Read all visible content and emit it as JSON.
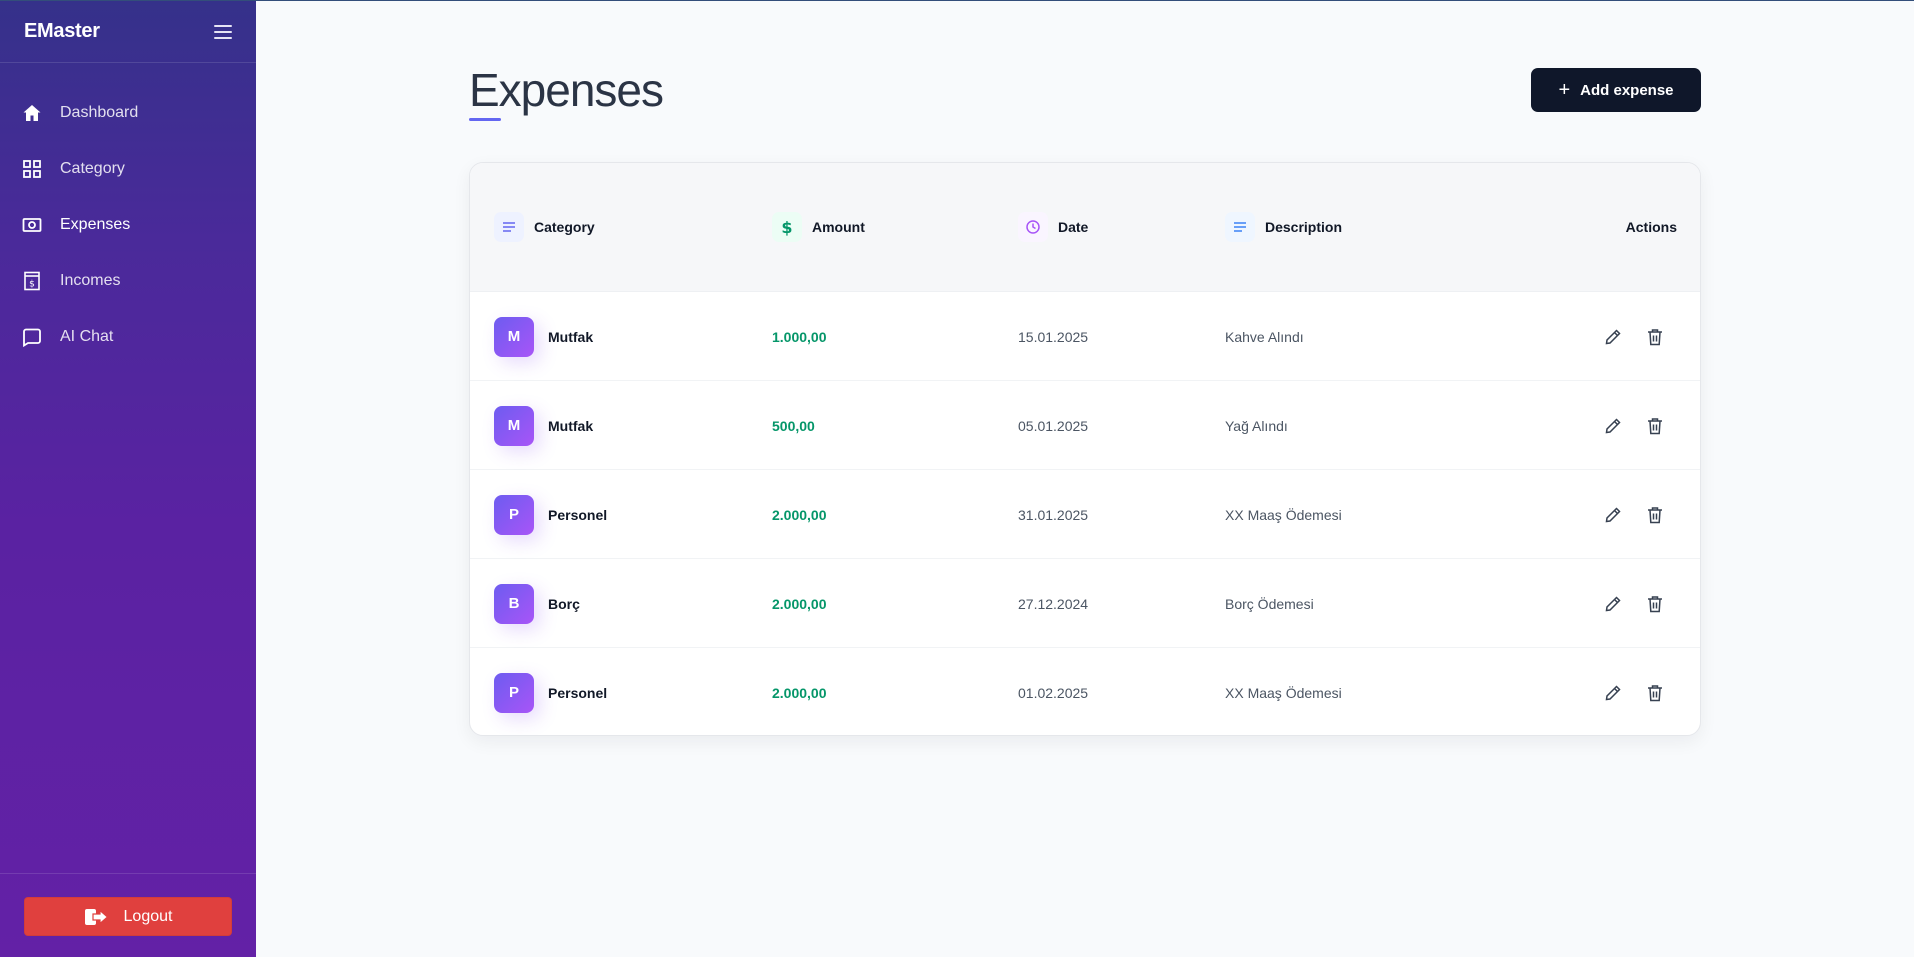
{
  "app": {
    "brand": "EMaster"
  },
  "sidebar": {
    "items": [
      {
        "label": "Dashboard",
        "icon": "home-icon"
      },
      {
        "label": "Category",
        "icon": "grid-icon"
      },
      {
        "label": "Expenses",
        "icon": "cash-icon",
        "active": true
      },
      {
        "label": "Incomes",
        "icon": "receipt-icon"
      },
      {
        "label": "AI Chat",
        "icon": "chat-icon"
      }
    ],
    "logout_label": "Logout"
  },
  "page": {
    "title": "Expenses",
    "add_button_label": "Add expense"
  },
  "table": {
    "headers": {
      "category": "Category",
      "amount": "Amount",
      "date": "Date",
      "description": "Description",
      "actions": "Actions"
    },
    "rows": [
      {
        "initial": "M",
        "category": "Mutfak",
        "amount": "1.000,00",
        "date": "15.01.2025",
        "description": "Kahve Alındı"
      },
      {
        "initial": "M",
        "category": "Mutfak",
        "amount": "500,00",
        "date": "05.01.2025",
        "description": "Yağ Alındı"
      },
      {
        "initial": "P",
        "category": "Personel",
        "amount": "2.000,00",
        "date": "31.01.2025",
        "description": "XX Maaş Ödemesi"
      },
      {
        "initial": "B",
        "category": "Borç",
        "amount": "2.000,00",
        "date": "27.12.2024",
        "description": "Borç Ödemesi"
      },
      {
        "initial": "P",
        "category": "Personel",
        "amount": "2.000,00",
        "date": "01.02.2025",
        "description": "XX Maaş Ödemesi"
      }
    ]
  },
  "colors": {
    "accent": "#6366f1",
    "amount": "#059669",
    "logout": "#e0403e",
    "primary_button": "#0f172a"
  }
}
